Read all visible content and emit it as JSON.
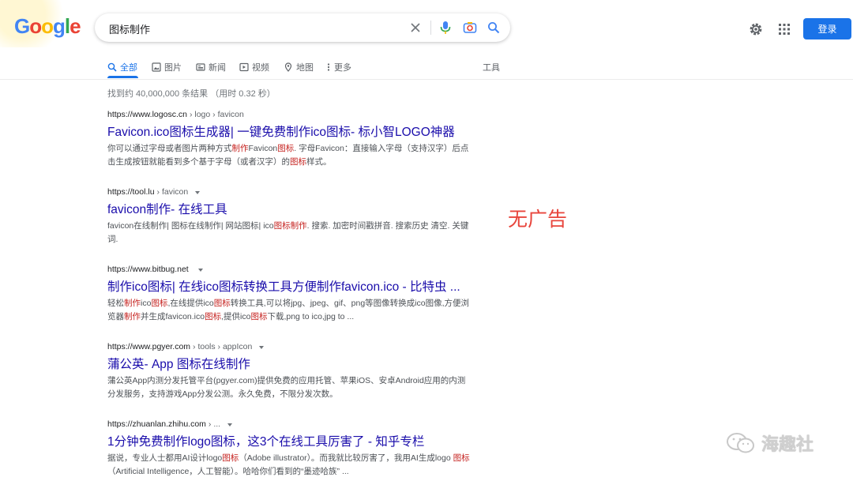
{
  "header": {
    "logo_letters": [
      "G",
      "o",
      "o",
      "g",
      "l",
      "e"
    ],
    "search_value": "图标制作",
    "login_label": "登录"
  },
  "tabs": [
    {
      "label": "全部",
      "icon": "search-icon",
      "active": true
    },
    {
      "label": "图片",
      "icon": "image-icon",
      "active": false
    },
    {
      "label": "新闻",
      "icon": "news-icon",
      "active": false
    },
    {
      "label": "视频",
      "icon": "video-icon",
      "active": false
    },
    {
      "label": "地图",
      "icon": "map-pin-icon",
      "active": false
    },
    {
      "label": "更多",
      "icon": "more-vert-icon",
      "active": false
    }
  ],
  "tools_label": "工具",
  "stats": "找到约 40,000,000 条结果 （用时 0.32 秒）",
  "results": [
    {
      "url_domain": "https://www.logosc.cn",
      "url_path": " › logo › favicon",
      "title": "Favicon.ico图标生成器| 一键免费制作ico图标- 标小智LOGO神器",
      "snippet_html": "你可以通过字母或者图片两种方式<span class=\"hl\">制作</span>Favicon<span class=\"hl\">图标</span>. 字母Favicon：直接输入字母（支持汉字）后点击生成按钮就能看到多个基于字母（或者汉字）的<span class=\"hl\">图标</span>样式。"
    },
    {
      "url_domain": "https://tool.lu",
      "url_path": " › favicon",
      "title": "favicon制作- 在线工具",
      "snippet_html": "favicon在线制作| 图标在线制作| 网站图标| ico<span class=\"hl\">图标制作</span>. 搜索. 加密时间戳拼音. 搜索历史 清空. 关键词."
    },
    {
      "url_domain": "https://www.bitbug.net",
      "url_path": "",
      "title": "制作ico图标| 在线ico图标转换工具方便制作favicon.ico - 比特虫 ...",
      "snippet_html": "轻松<span class=\"hl\">制作</span>ico<span class=\"hl\">图标</span>,在线提供ico<span class=\"hl\">图标</span>转换工具,可以将jpg、jpeg、gif、png等图像转换成ico图像,方便浏览器<span class=\"hl\">制作</span>并生成favicon.ico<span class=\"hl\">图标</span>,提供ico<span class=\"hl\">图标</span>下载,png to ico,jpg to ..."
    },
    {
      "url_domain": "https://www.pgyer.com",
      "url_path": " › tools › appIcon",
      "title": "蒲公英- App 图标在线制作",
      "snippet_html": "蒲公英App内测分发托管平台(pgyer.com)提供免费的应用托管、苹果iOS、安卓Android应用的内测分发服务，支持游戏App分发公测。永久免费，不限分发次数。"
    },
    {
      "url_domain": "https://zhuanlan.zhihu.com",
      "url_path": " › ...",
      "title": "1分钟免费制作logo图标，这3个在线工具厉害了 - 知乎专栏",
      "snippet_html": "据说，专业人士都用AI设计logo<span class=\"hl\">图标</span>（Adobe illustrator）。而我就比较厉害了，我用AI生成logo <span class=\"hl\">图标</span>（Artificial Intelligence，人工智能）。哈哈你们看到的“墨迹哈族” ..."
    }
  ],
  "annotation": "无广告",
  "watermark": "海趣社",
  "colors": {
    "accent": "#1a73e8",
    "link": "#1a0dab",
    "highlight": "#c5221f",
    "annotation": "#e8453c"
  }
}
